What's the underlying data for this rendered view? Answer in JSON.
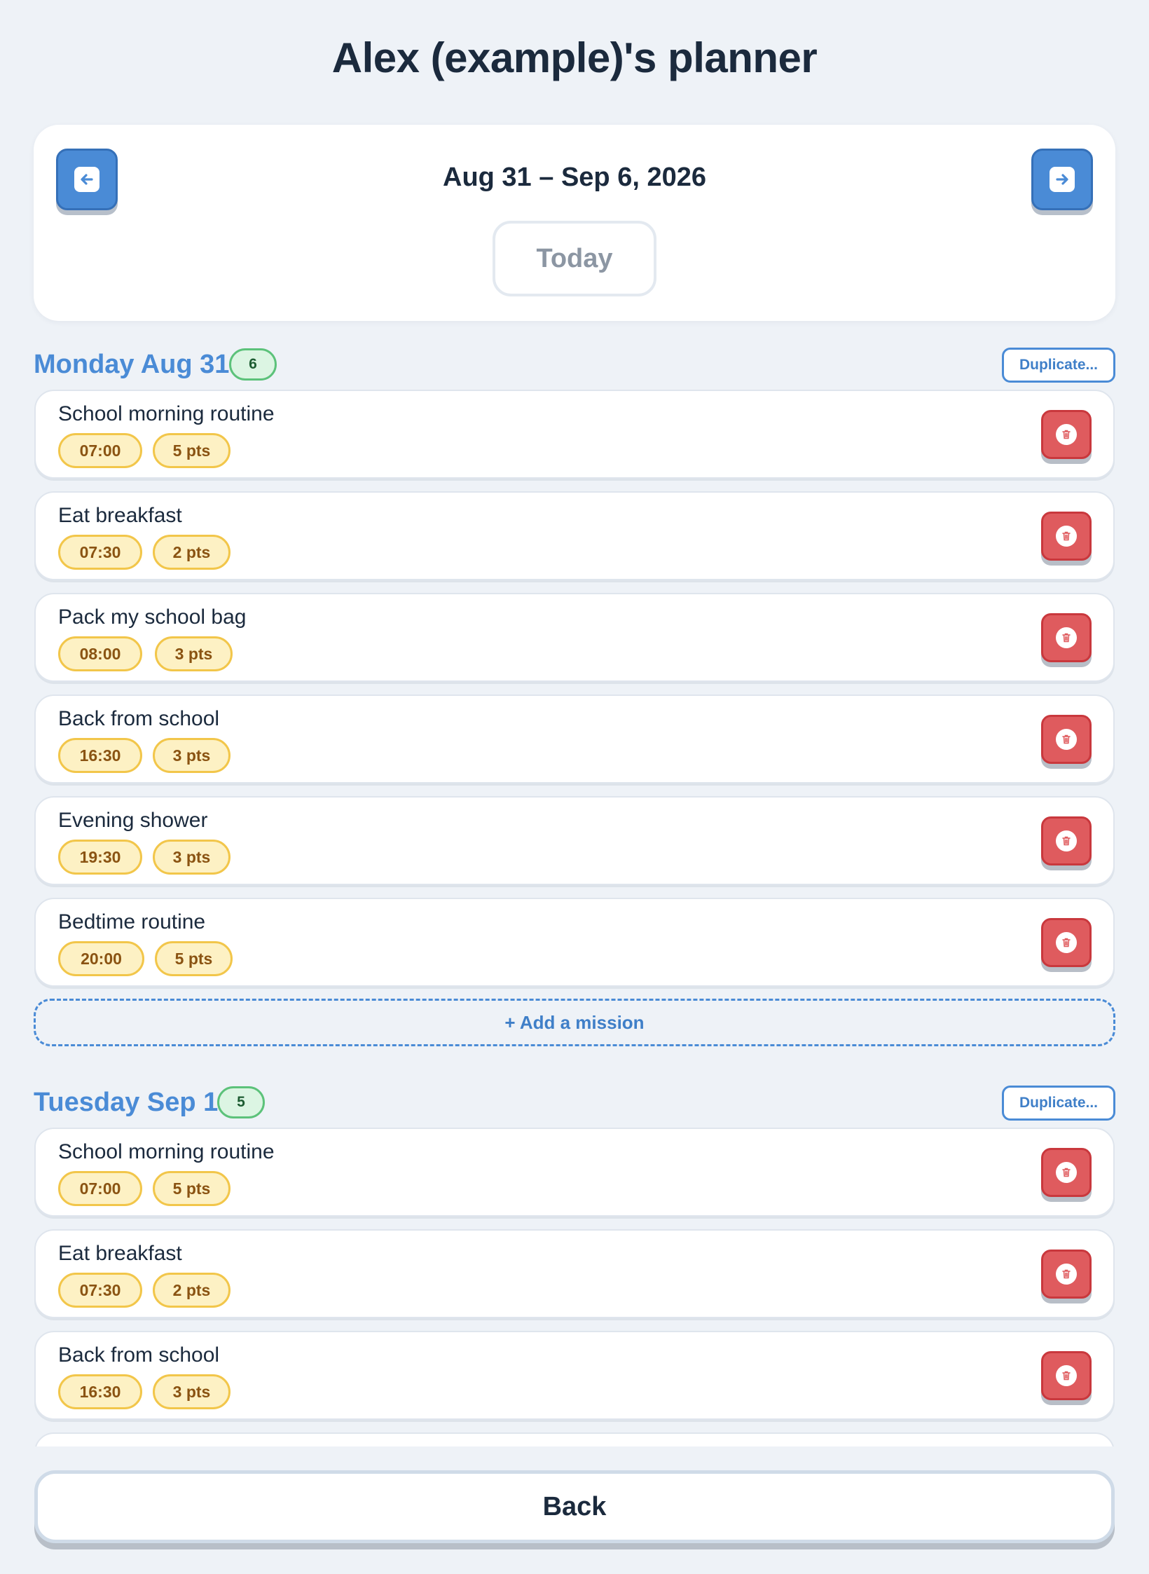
{
  "page": {
    "title": "Alex (example)'s planner"
  },
  "week": {
    "range": "Aug 31 – Sep 6, 2026",
    "today_label": "Today"
  },
  "days": [
    {
      "title": "Monday Aug 31",
      "count": "6",
      "duplicate_label": "Duplicate...",
      "add_label": "+ Add a mission",
      "tasks": [
        {
          "title": "School morning routine",
          "time": "07:00",
          "points": "5 pts"
        },
        {
          "title": "Eat breakfast",
          "time": "07:30",
          "points": "2 pts"
        },
        {
          "title": "Pack my school bag",
          "time": "08:00",
          "points": "3 pts"
        },
        {
          "title": "Back from school",
          "time": "16:30",
          "points": "3 pts"
        },
        {
          "title": "Evening shower",
          "time": "19:30",
          "points": "3 pts"
        },
        {
          "title": "Bedtime routine",
          "time": "20:00",
          "points": "5 pts"
        }
      ]
    },
    {
      "title": "Tuesday Sep 1",
      "count": "5",
      "duplicate_label": "Duplicate...",
      "tasks": [
        {
          "title": "School morning routine",
          "time": "07:00",
          "points": "5 pts"
        },
        {
          "title": "Eat breakfast",
          "time": "07:30",
          "points": "2 pts"
        },
        {
          "title": "Back from school",
          "time": "16:30",
          "points": "3 pts"
        }
      ]
    }
  ],
  "footer": {
    "back_label": "Back"
  },
  "icons": {
    "prev": "arrow-left-icon",
    "next": "arrow-right-icon",
    "delete": "trash-icon"
  },
  "colors": {
    "accent": "#4a8bd6",
    "delete": "#df5b5e",
    "chip_bg": "#fdf1c4",
    "badge_bg": "#dcf5e3",
    "background": "#eef2f7"
  }
}
